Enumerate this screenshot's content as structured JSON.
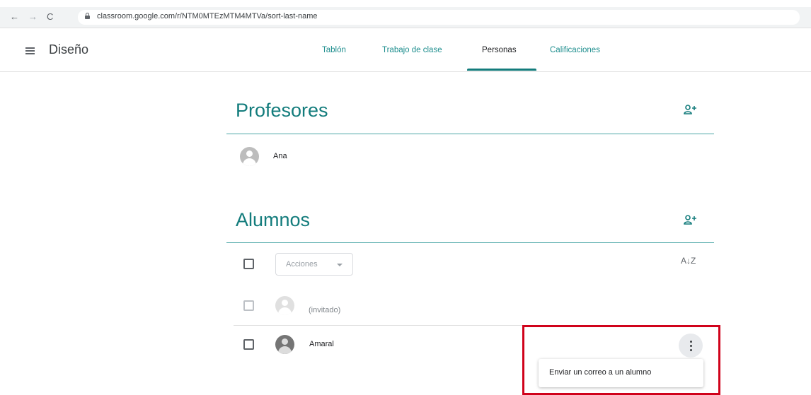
{
  "browser": {
    "back_icon": "←",
    "forward_icon": "→",
    "reload_icon": "C",
    "url": "classroom.google.com/r/NTM0MTEzMTM4MTVa/sort-last-name"
  },
  "header": {
    "title": "Diseño",
    "tabs": [
      {
        "label": "Tablón",
        "active": false
      },
      {
        "label": "Trabajo de clase",
        "active": false
      },
      {
        "label": "Personas",
        "active": true
      },
      {
        "label": "Calificaciones",
        "active": false
      }
    ],
    "accent_color": "#137c7c"
  },
  "teachers": {
    "title": "Profesores",
    "people": [
      {
        "name": "Ana"
      }
    ]
  },
  "students": {
    "title": "Alumnos",
    "actions_label": "Acciones",
    "sort_icon": "A↓Z",
    "people": [
      {
        "name": "(invitado)",
        "invited": true
      },
      {
        "name": "Amaral",
        "invited": false
      }
    ],
    "menu": {
      "item": "Enviar un correo a un alumno"
    }
  },
  "highlight_color": "#d0021b"
}
